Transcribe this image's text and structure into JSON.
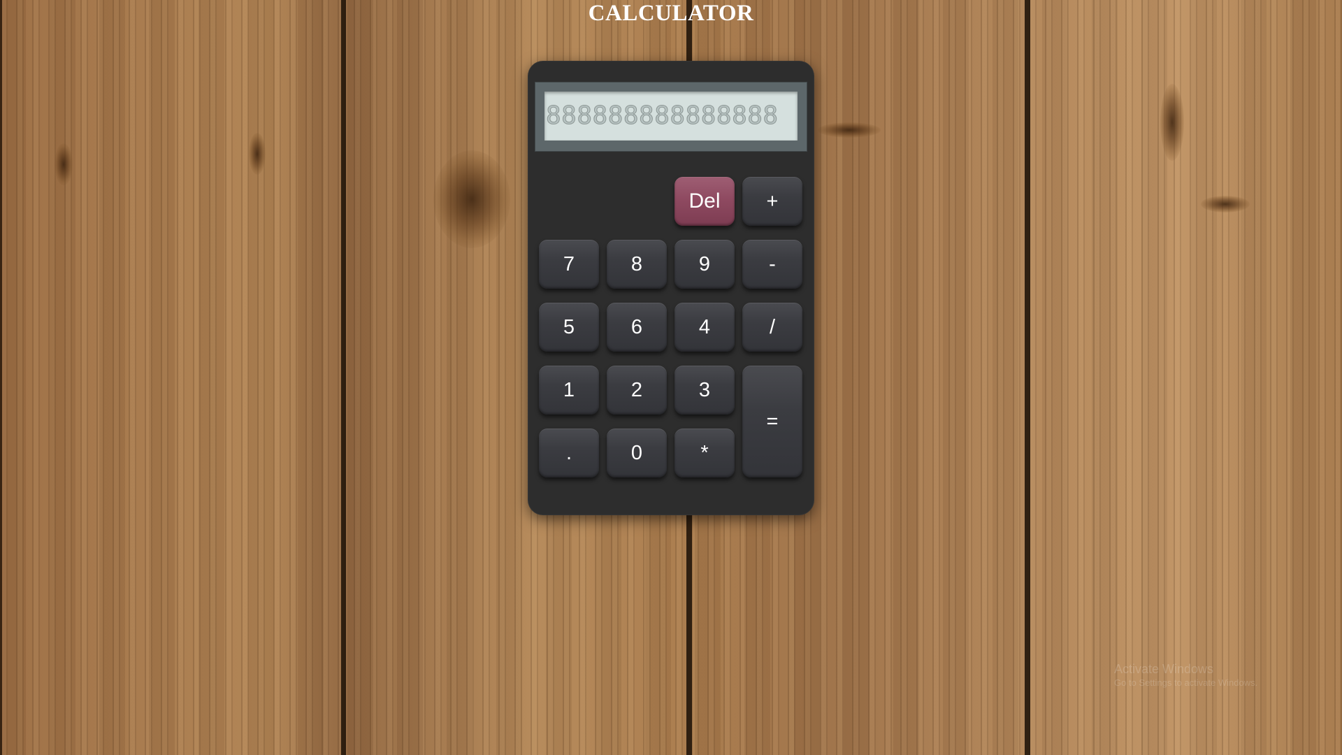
{
  "page": {
    "title": "CALCULATOR"
  },
  "display": {
    "value": "888888888888888"
  },
  "keys": {
    "del": "Del",
    "plus": "+",
    "seven": "7",
    "eight": "8",
    "nine": "9",
    "minus": "-",
    "five": "5",
    "six": "6",
    "four": "4",
    "divide": "/",
    "one": "1",
    "two": "2",
    "three": "3",
    "equals": "=",
    "dot": ".",
    "zero": "0",
    "multiply": "*"
  },
  "watermark": {
    "title": "Activate Windows",
    "subtitle": "Go to Settings to activate Windows."
  },
  "colors": {
    "calculator_body": "#2d2d2d",
    "display_frame": "#5d676a",
    "display_screen": "#d5e0de",
    "key": "#3b3c41",
    "del_key": "#8f4a61",
    "text": "#ffffff"
  }
}
